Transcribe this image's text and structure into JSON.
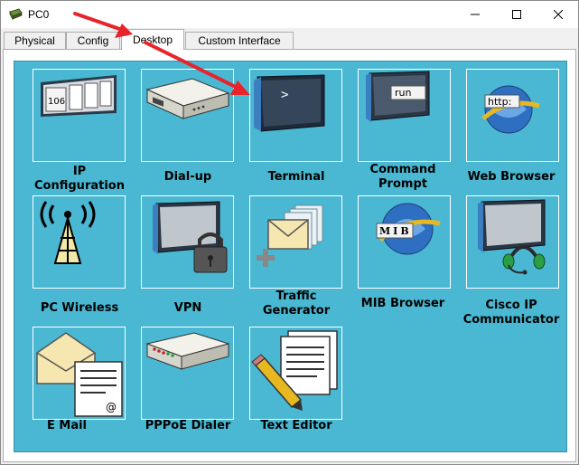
{
  "window": {
    "title": "PC0"
  },
  "tabs": [
    {
      "label": "Physical"
    },
    {
      "label": "Config"
    },
    {
      "label": "Desktop",
      "active": true
    },
    {
      "label": "Custom Interface"
    }
  ],
  "desktop": {
    "apps": [
      {
        "label_line1": "IP",
        "label_line2": "Configuration",
        "icon": "ip-configuration-icon",
        "icon_text": "106"
      },
      {
        "label_line1": "Dial-up",
        "label_line2": "",
        "icon": "modem-icon"
      },
      {
        "label_line1": "Terminal",
        "label_line2": "",
        "icon": "terminal-icon",
        "icon_text": ">"
      },
      {
        "label_line1": "Command",
        "label_line2": "Prompt",
        "icon": "command-prompt-icon",
        "icon_text": "run"
      },
      {
        "label_line1": "Web Browser",
        "label_line2": "",
        "icon": "web-browser-icon",
        "icon_text": "http:"
      },
      {
        "label_line1": "PC Wireless",
        "label_line2": "",
        "icon": "wireless-tower-icon"
      },
      {
        "label_line1": "VPN",
        "label_line2": "",
        "icon": "vpn-lock-icon"
      },
      {
        "label_line1": "Traffic",
        "label_line2": "Generator",
        "icon": "traffic-generator-icon"
      },
      {
        "label_line1": "MIB Browser",
        "label_line2": "",
        "icon": "mib-browser-icon",
        "icon_text": "MIB"
      },
      {
        "label_line1": "Cisco IP",
        "label_line2": "Communicator",
        "icon": "ip-communicator-icon"
      },
      {
        "label_line1": "E Mail",
        "label_line2": "",
        "icon": "email-icon",
        "icon_text": "@"
      },
      {
        "label_line1": "PPPoE Dialer",
        "label_line2": "",
        "icon": "pppoe-dialer-icon"
      },
      {
        "label_line1": "Text Editor",
        "label_line2": "",
        "icon": "text-editor-icon"
      }
    ]
  },
  "colors": {
    "desktop_bg": "#4ab8d2",
    "annotation_arrow": "#e8232a"
  }
}
